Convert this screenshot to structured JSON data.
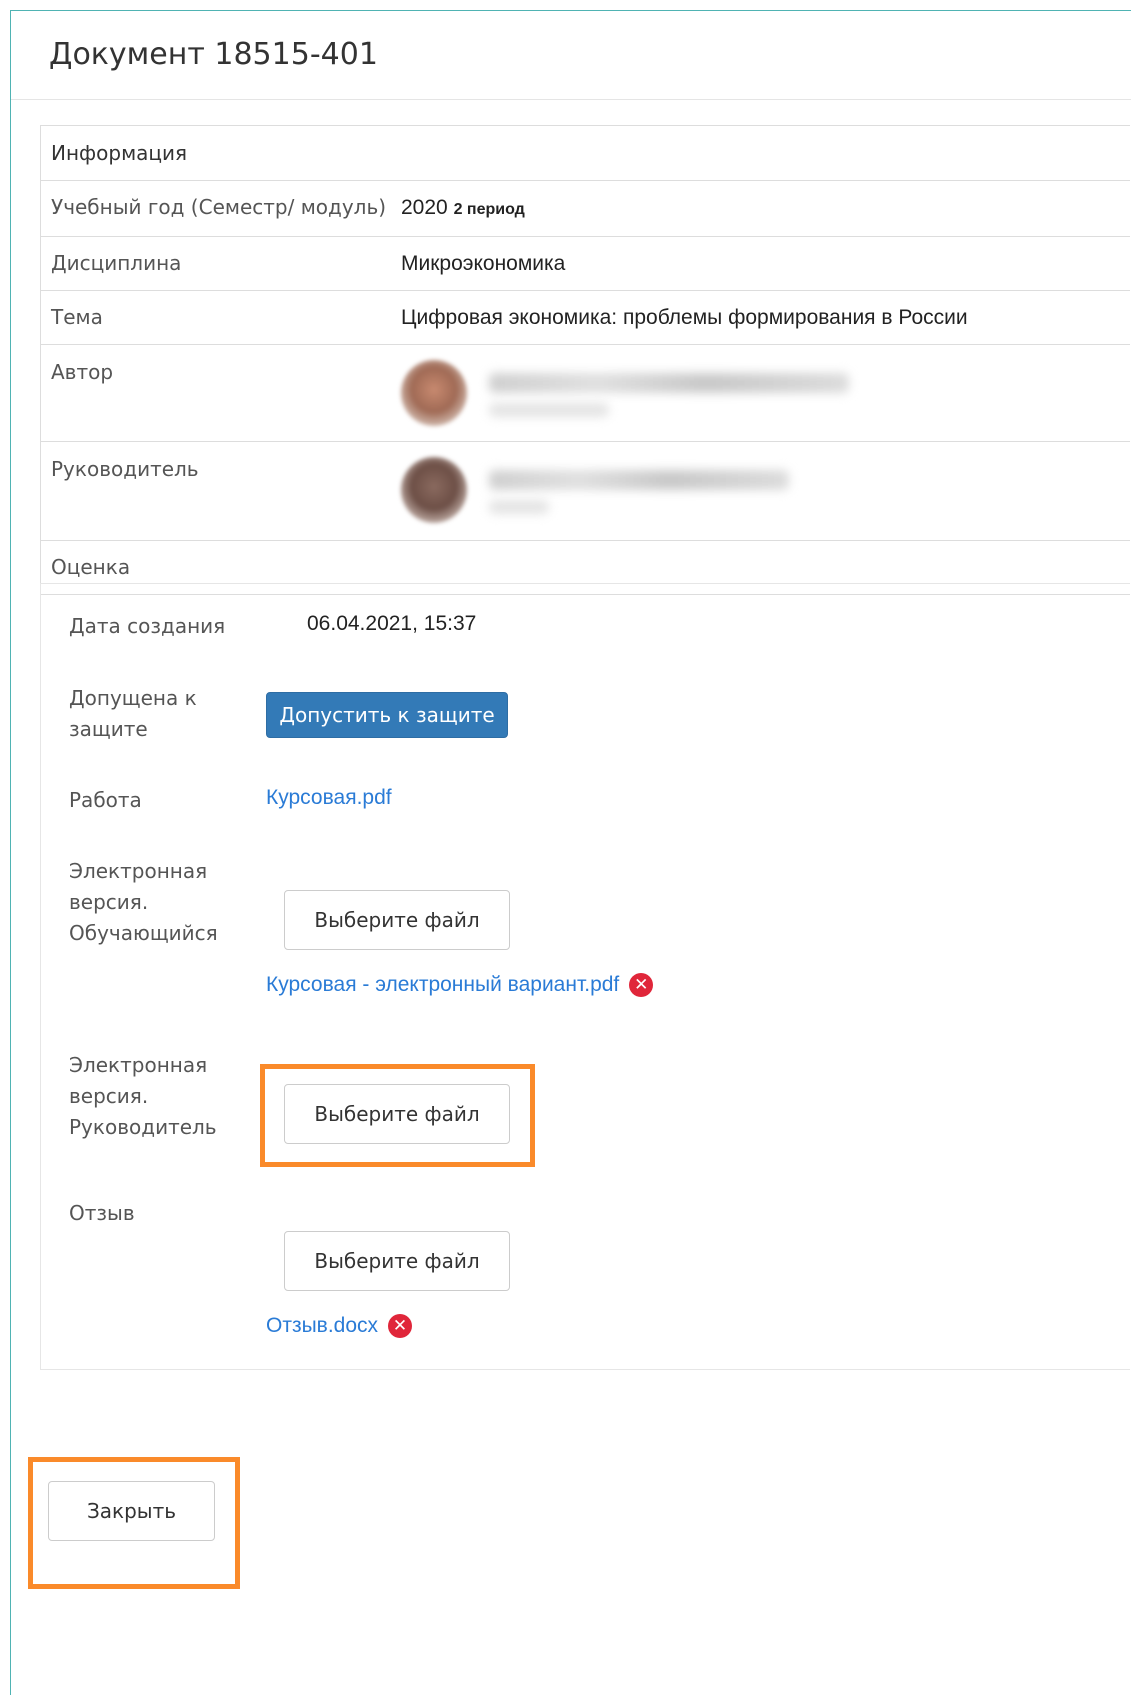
{
  "header": {
    "title": "Документ 18515-401"
  },
  "info": {
    "section_title": "Информация",
    "rows": [
      {
        "label": "Учебный год (Семестр/ модуль)",
        "value": "2020",
        "value_suffix": "2 период"
      },
      {
        "label": "Дисциплина",
        "value": "Микроэкономика"
      },
      {
        "label": "Тема",
        "value": "Цифровая экономика: проблемы формирования в России"
      },
      {
        "label": "Автор"
      },
      {
        "label": "Руководитель"
      },
      {
        "label": "Оценка",
        "value": ""
      }
    ]
  },
  "details": {
    "created_label": "Дата создания",
    "created_value": "06.04.2021, 15:37",
    "admitted_label": "Допущена к защите",
    "admit_button": "Допустить к защите",
    "work_label": "Работа",
    "work_file": "Курсовая.pdf",
    "student_version_label": "Электронная версия. Обучающийся",
    "choose_file_button": "Выберите файл",
    "student_file": "Курсовая - электронный вариант.pdf",
    "supervisor_version_label": "Электронная версия. Руководитель",
    "review_label": "Отзыв",
    "review_file": "Отзыв.docx"
  },
  "footer": {
    "close_button": "Закрыть"
  },
  "colors": {
    "primary_button": "#337ab7",
    "link": "#2a7bd6",
    "remove_icon": "#e0263a",
    "highlight": "#fa8a2a"
  },
  "icons": {
    "remove": "remove-icon"
  }
}
